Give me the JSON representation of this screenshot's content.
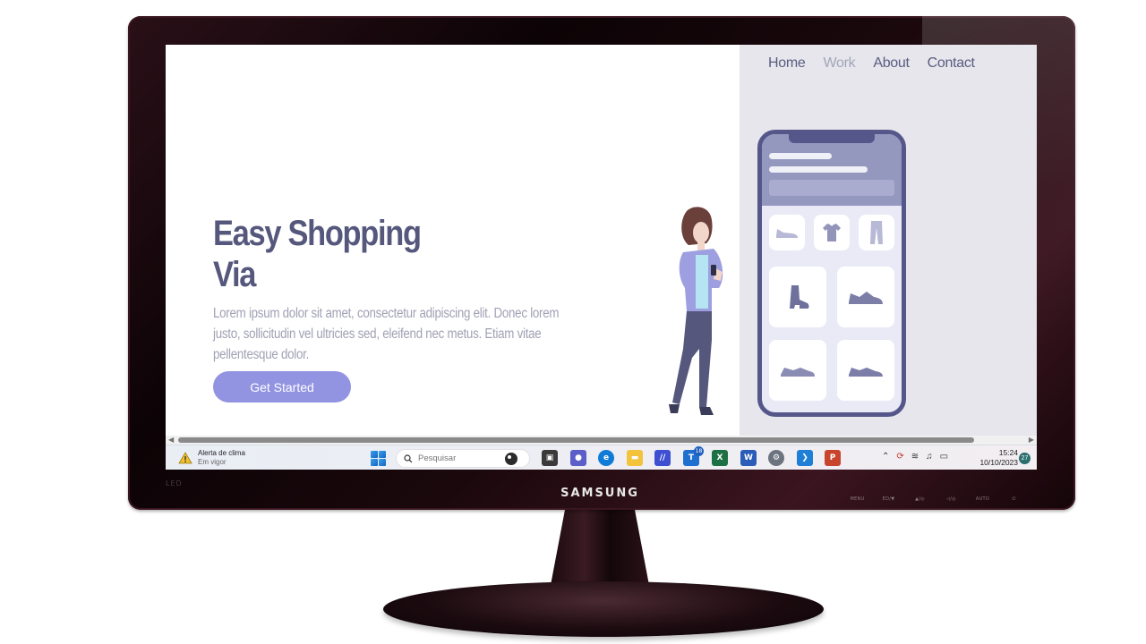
{
  "monitor": {
    "brand": "SAMSUNG",
    "led_label": "LED",
    "buttons": [
      "MENU",
      "ED/▼",
      "▲/◎",
      "◁/◎",
      "AUTO",
      "⏻"
    ]
  },
  "website": {
    "nav": {
      "home": "Home",
      "work": "Work",
      "about": "About",
      "contact": "Contact"
    },
    "hero": {
      "title_line1": "Easy Shopping",
      "title_line2": "Via",
      "paragraph": "Lorem ipsum dolor sit amet, consectetur adipiscing elit. Donec lorem justo, sollicitudin vel ultricies sed, eleifend nec metus. Etiam vitae pellentesque dolor.",
      "cta_label": "Get Started"
    },
    "colors": {
      "accent": "#9294e2",
      "title": "#55587c",
      "panel": "#e6e6ec"
    },
    "illustration": {
      "phone_items": [
        "sneaker-icon",
        "tshirt-icon",
        "pants-icon",
        "boot-icon",
        "sneaker-icon",
        "shoe-icon",
        "shoe-icon"
      ]
    }
  },
  "taskbar": {
    "weather_title": "Alerta de clima",
    "weather_sub": "Em vigor",
    "search_placeholder": "Pesquisar",
    "teams_badge": "18",
    "time": "15:24",
    "date": "10/10/2023",
    "notification_count": "27"
  }
}
